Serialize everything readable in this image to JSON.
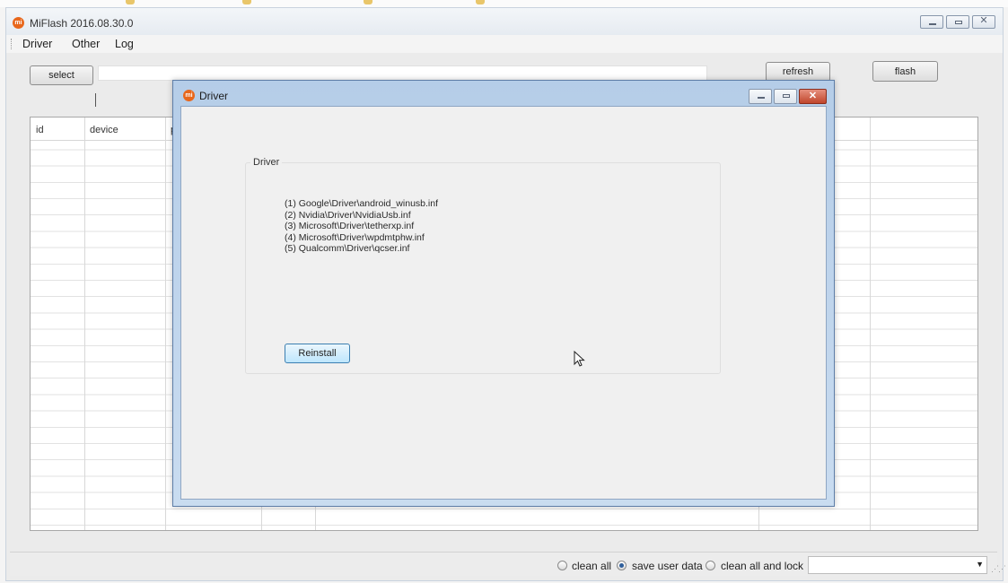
{
  "main_window": {
    "title": "MiFlash 2016.08.30.0",
    "icon": "mi-logo-icon",
    "icon_text": "mi"
  },
  "menu": [
    "Driver",
    "Other",
    "Log"
  ],
  "toolbar": {
    "select_label": "select",
    "path_value": "",
    "refresh_label": "refresh",
    "flash_label": "flash"
  },
  "grid": {
    "columns": [
      "id",
      "device",
      "p",
      "",
      "",
      "",
      "",
      ""
    ],
    "rows": []
  },
  "statusbar": {
    "options": [
      {
        "label": "clean all",
        "selected": false
      },
      {
        "label": "save user data",
        "selected": true
      },
      {
        "label": "clean all and lock",
        "selected": false
      }
    ],
    "dropdown_value": ""
  },
  "dialog": {
    "title": "Driver",
    "group_label": "Driver",
    "drivers": [
      "(1) Google\\Driver\\android_winusb.inf",
      "(2) Nvidia\\Driver\\NvidiaUsb.inf",
      "(3) Microsoft\\Driver\\tetherxp.inf",
      "(4) Microsoft\\Driver\\wpdmtphw.inf",
      "(5) Qualcomm\\Driver\\qcser.inf"
    ],
    "reinstall_label": "Reinstall"
  },
  "colors": {
    "dialog_frame": "#b5cde8",
    "close_button": "#c0462c",
    "reinstall_button": "#bee6fd",
    "app_icon": "#e8671c"
  }
}
